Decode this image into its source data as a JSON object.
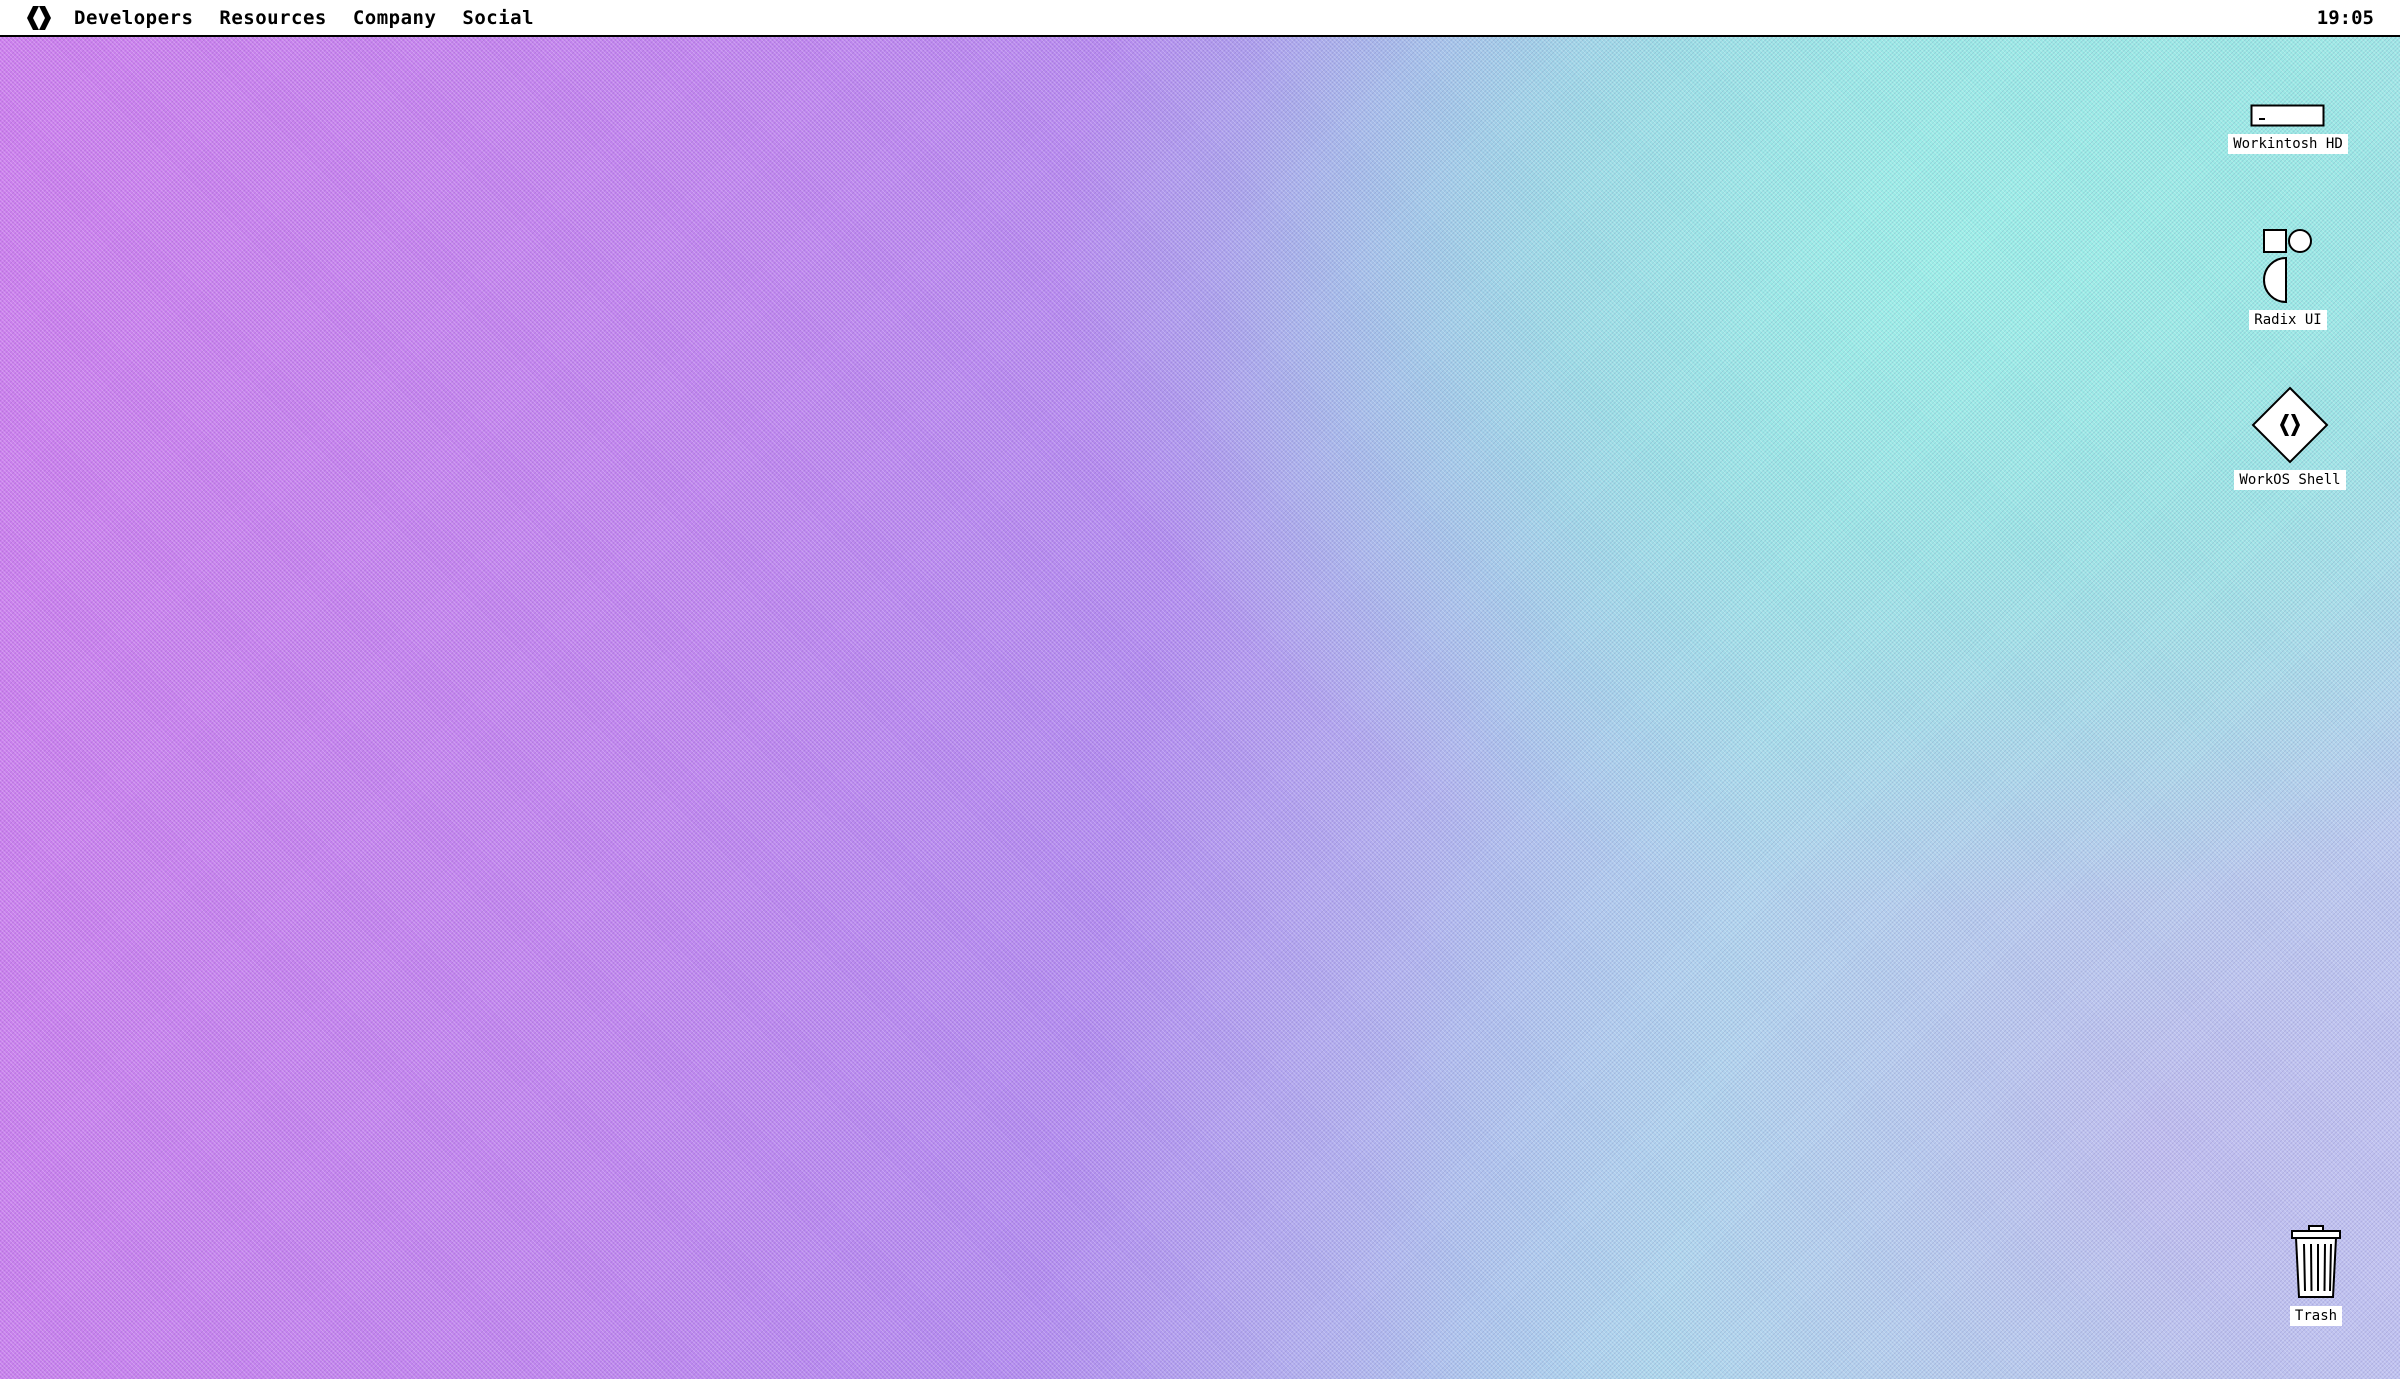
{
  "menubar": {
    "logo_icon": "workos-logo-icon",
    "items": [
      {
        "label": "Developers"
      },
      {
        "label": "Resources"
      },
      {
        "label": "Company"
      },
      {
        "label": "Social"
      }
    ],
    "clock": "19:05"
  },
  "desktop": {
    "icons": [
      {
        "label": "Workintosh HD",
        "icon": "hard-drive-icon"
      },
      {
        "label": "Radix UI",
        "icon": "radix-shapes-icon"
      },
      {
        "label": "WorkOS Shell",
        "icon": "workos-diamond-icon"
      },
      {
        "label": "Trash",
        "icon": "trash-can-icon"
      }
    ]
  },
  "colors": {
    "menubar_bg": "#ffffff",
    "text": "#000000",
    "wallpaper_purple": "#c086ef",
    "wallpaper_cyan": "#a6ebe8"
  }
}
